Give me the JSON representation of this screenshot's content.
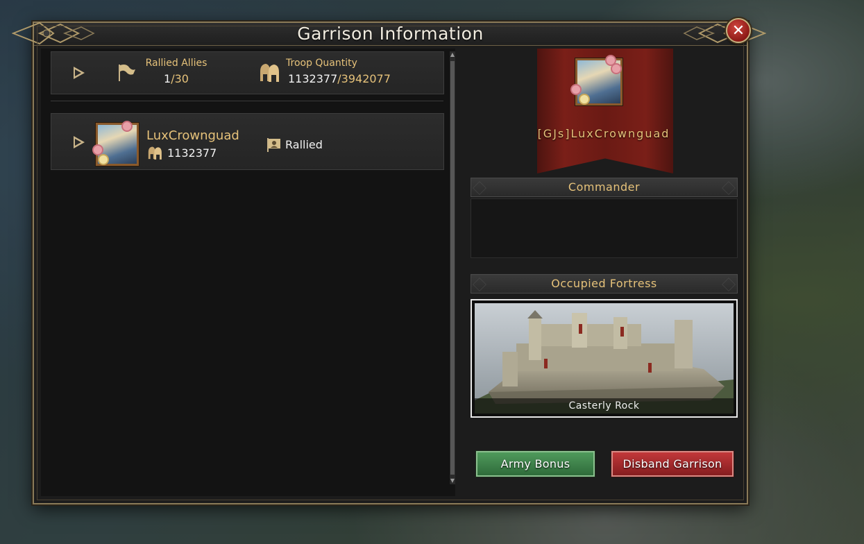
{
  "dialog": {
    "title": "Garrison Information",
    "close_label": "✕"
  },
  "summary": {
    "rallied_allies_label": "Rallied Allies",
    "rallied_current": "1",
    "rallied_max": "30",
    "troop_quantity_label": "Troop Quantity",
    "troop_current": "1132377",
    "troop_max": "3942077"
  },
  "members": [
    {
      "name": "LuxCrownguad",
      "troops": "1132377",
      "status": "Rallied"
    }
  ],
  "right_panel": {
    "commander_name": "[GJs]LuxCrownguad",
    "commander_header": "Commander",
    "fortress_header": "Occupied Fortress",
    "fortress_name": "Casterly Rock",
    "army_bonus_label": "Army Bonus",
    "disband_label": "Disband Garrison"
  },
  "colors": {
    "accent_gold": "#e6c27a",
    "button_green": "#3f8a4c",
    "button_red": "#a52a2c",
    "banner_red": "#6a1a14"
  }
}
